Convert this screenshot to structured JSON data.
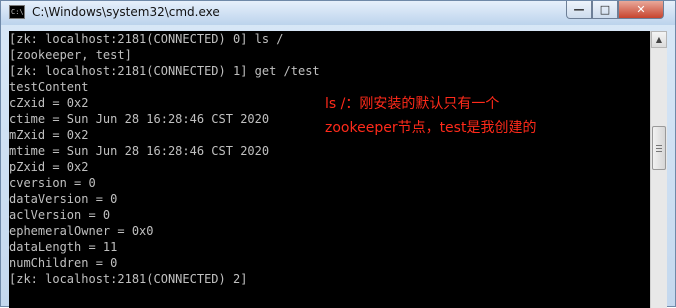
{
  "window": {
    "title": "C:\\Windows\\system32\\cmd.exe",
    "icon": "cmd-app-icon",
    "icon_text": "C:\\",
    "controls": {
      "minimize": "—",
      "maximize": "□",
      "close": "✕"
    }
  },
  "console": {
    "lines": [
      "[zk: localhost:2181(CONNECTED) 0] ls /",
      "[zookeeper, test]",
      "[zk: localhost:2181(CONNECTED) 1] get /test",
      "testContent",
      "cZxid = 0x2",
      "ctime = Sun Jun 28 16:28:46 CST 2020",
      "mZxid = 0x2",
      "mtime = Sun Jun 28 16:28:46 CST 2020",
      "pZxid = 0x2",
      "cversion = 0",
      "dataVersion = 0",
      "aclVersion = 0",
      "ephemeralOwner = 0x0",
      "dataLength = 11",
      "numChildren = 0",
      "[zk: localhost:2181(CONNECTED) 2]"
    ]
  },
  "annotation": {
    "line1": "ls /：刚安装的默认只有一个",
    "line2": "zookeeper节点，test是我创建的",
    "color": "#ff2a1a"
  },
  "scrollbar": {
    "up_arrow": "▲"
  }
}
